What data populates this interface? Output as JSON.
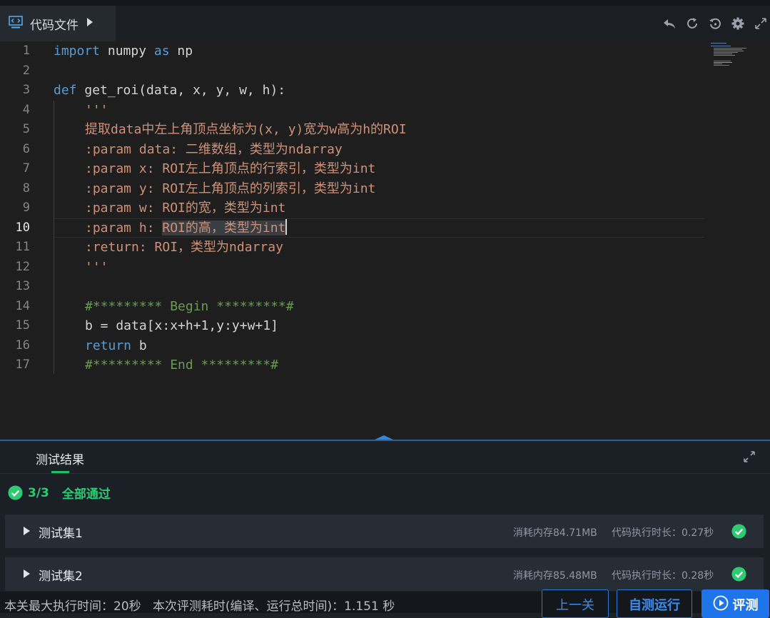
{
  "tab": {
    "file_label": "代码文件"
  },
  "toolbar": {
    "icons": [
      "undo-icon",
      "refresh-icon",
      "history-icon",
      "gear-icon",
      "fullscreen-icon"
    ]
  },
  "editor": {
    "line_numbers": [
      "1",
      "2",
      "3",
      "4",
      "5",
      "6",
      "7",
      "8",
      "9",
      "10",
      "11",
      "12",
      "13",
      "14",
      "15",
      "16",
      "17"
    ],
    "active_line": 10,
    "code": {
      "l1_kw1": "import",
      "l1_mod": " numpy ",
      "l1_kw2": "as",
      "l1_alias": " np",
      "l3_kw": "def",
      "l3_sig": " get_roi(data, x, y, w, h):",
      "l4": "'''",
      "l5": "提取data中左上角顶点坐标为(x, y)宽为w高为h的ROI",
      "l6": ":param data: 二维数组，类型为ndarray",
      "l7": ":param x: ROI左上角顶点的行索引，类型为int",
      "l8": ":param y: ROI左上角顶点的列索引，类型为int",
      "l9": ":param w: ROI的宽，类型为int",
      "l10_a": ":param h: ",
      "l10_b": "ROI的高，类型为int",
      "l11": ":return: ROI，类型为ndarray",
      "l12": "'''",
      "l14": "#********* Begin *********#",
      "l15": "b = data[x:x+h+1,y:y+w+1]",
      "l16_kw": "return",
      "l16_rest": " b",
      "l17": "#********* End *********#"
    }
  },
  "results": {
    "tab_label": "测试结果",
    "score": "3/3",
    "status": "全部通过",
    "cases": [
      {
        "name": "测试集1",
        "memory": "消耗内存84.71MB",
        "time": "代码执行时长：0.27秒"
      },
      {
        "name": "测试集2",
        "memory": "消耗内存85.48MB",
        "time": "代码执行时长：0.28秒"
      }
    ]
  },
  "footer": {
    "max_time": "本关最大执行时间：20秒",
    "eval_time": "本次评测耗时(编译、运行总时间)：1.151 秒",
    "prev_button": "上一关",
    "self_test_button": "自测运行",
    "evaluate_button": "评测"
  },
  "colors": {
    "keyword": "#569cd6",
    "string": "#ce9178",
    "comment": "#6a9955",
    "success": "#2ecb73",
    "primary": "#1e74e8"
  }
}
